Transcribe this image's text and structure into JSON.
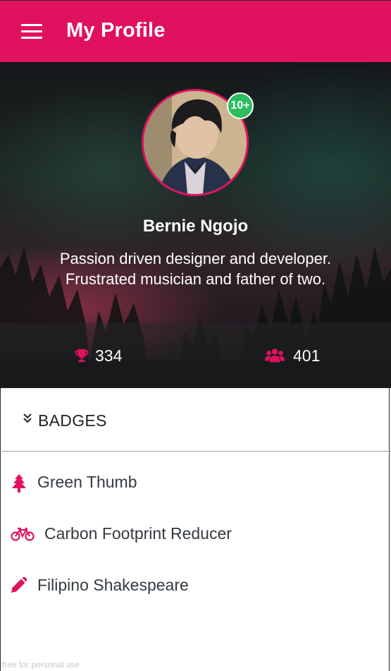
{
  "app_bar": {
    "title": "My Profile",
    "menu_icon": "hamburger-menu-icon",
    "color": "#e0125f"
  },
  "profile": {
    "name": "Bernie Ngojo",
    "bio_line1": "Passion driven designer and developer.",
    "bio_line2": "Frustrated musician and father of two.",
    "level_badge": "10+",
    "level_badge_color": "#2bbd5e"
  },
  "stats": {
    "trophies": {
      "icon": "trophy-icon",
      "value": "334"
    },
    "followers": {
      "icon": "group-icon",
      "value": "401"
    }
  },
  "badges": {
    "header_label": "BADGES",
    "header_icon": "double-chevron-down-icon",
    "items": [
      {
        "label": "Green Thumb",
        "icon": "tree-icon"
      },
      {
        "label": "Carbon Footprint Reducer",
        "icon": "bicycle-icon"
      },
      {
        "label": "Filipino Shakespeare",
        "icon": "pencil-icon"
      }
    ]
  },
  "watermark": "free for personal use"
}
